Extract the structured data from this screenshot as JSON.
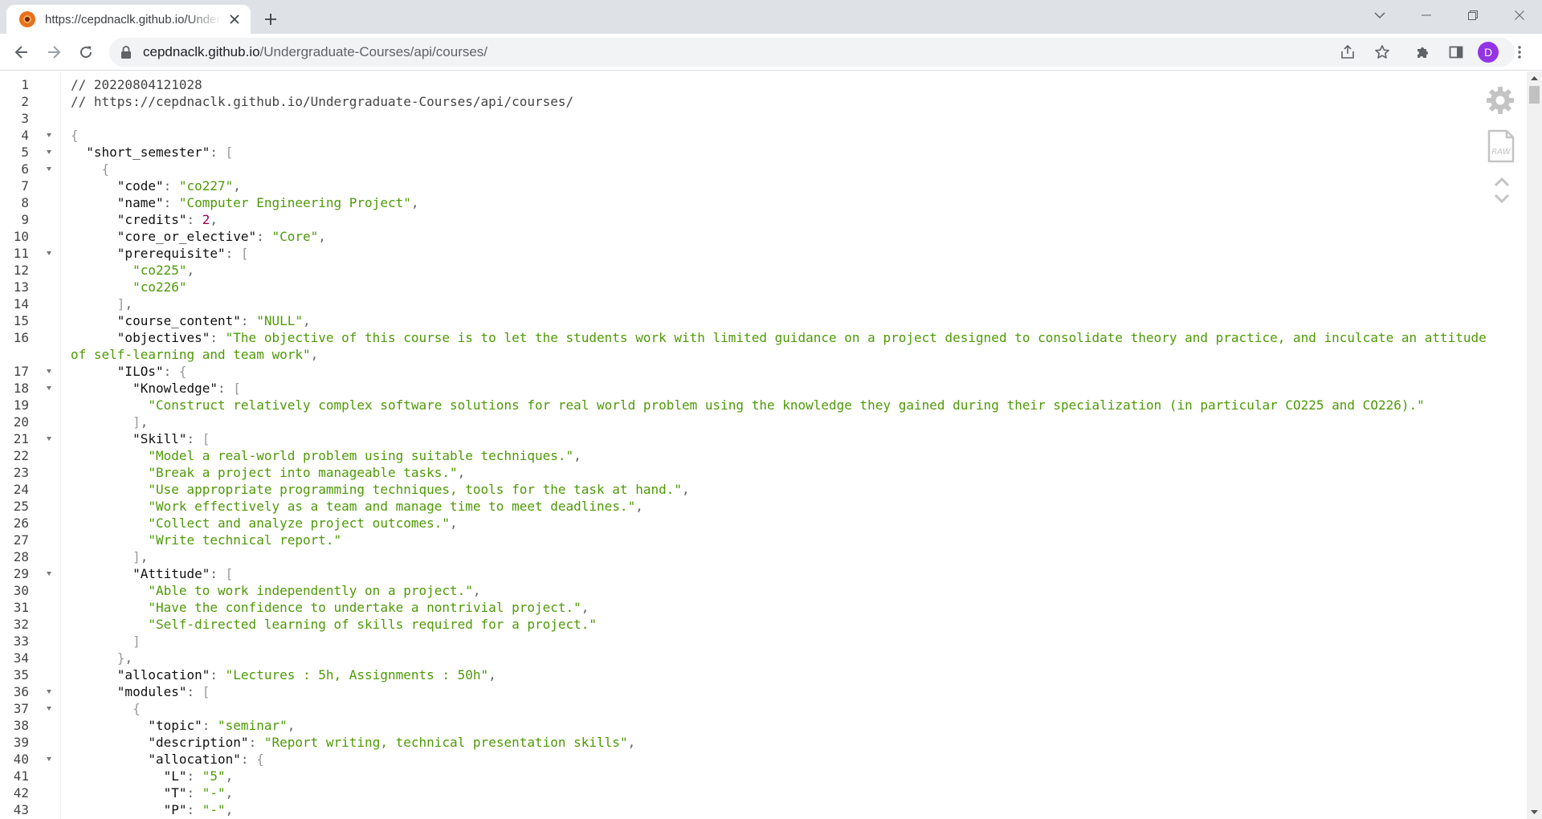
{
  "browser": {
    "tab_title": "https://cepdnaclk.github.io/Undergraduate-Courses/api/courses/",
    "url_host": "cepdnaclk.github.io",
    "url_path": "/Undergraduate-Courses/api/courses/",
    "profile_initial": "D"
  },
  "icons": {
    "favicon": "site-favicon",
    "tab_close": "close-icon",
    "new_tab": "plus-icon",
    "back": "arrow-left-icon",
    "forward": "arrow-right-icon",
    "reload": "reload-icon",
    "lock": "lock-icon",
    "share": "share-icon",
    "bookmark": "star-icon",
    "extensions": "puzzle-icon",
    "side_panel": "side-panel-icon",
    "menu": "kebab-menu-icon",
    "settings": "gear-icon",
    "raw": "raw-file-icon",
    "scroll_up": "chevron-up-icon",
    "scroll_down": "chevron-down-icon"
  },
  "viewer": {
    "raw_label": "RAW",
    "lines": [
      {
        "n": "1",
        "fold": false,
        "t": [
          [
            "c",
            "// 20220804121028"
          ]
        ]
      },
      {
        "n": "2",
        "fold": false,
        "t": [
          [
            "c",
            "// https://cepdnaclk.github.io/Undergraduate-Courses/api/courses/"
          ]
        ]
      },
      {
        "n": "3",
        "fold": false,
        "t": []
      },
      {
        "n": "4",
        "fold": true,
        "t": [
          [
            "b",
            "{"
          ]
        ]
      },
      {
        "n": "5",
        "fold": true,
        "t": [
          [
            "p",
            "  "
          ],
          [
            "k",
            "\"short_semester\""
          ],
          [
            "p",
            ": "
          ],
          [
            "b",
            "["
          ]
        ]
      },
      {
        "n": "6",
        "fold": true,
        "t": [
          [
            "p",
            "    "
          ],
          [
            "b",
            "{"
          ]
        ]
      },
      {
        "n": "7",
        "fold": false,
        "t": [
          [
            "p",
            "      "
          ],
          [
            "k",
            "\"code\""
          ],
          [
            "p",
            ": "
          ],
          [
            "s",
            "\"co227\""
          ],
          [
            "p",
            ","
          ]
        ]
      },
      {
        "n": "8",
        "fold": false,
        "t": [
          [
            "p",
            "      "
          ],
          [
            "k",
            "\"name\""
          ],
          [
            "p",
            ": "
          ],
          [
            "s",
            "\"Computer Engineering Project\""
          ],
          [
            "p",
            ","
          ]
        ]
      },
      {
        "n": "9",
        "fold": false,
        "t": [
          [
            "p",
            "      "
          ],
          [
            "k",
            "\"credits\""
          ],
          [
            "p",
            ": "
          ],
          [
            "n",
            "2"
          ],
          [
            "p",
            ","
          ]
        ]
      },
      {
        "n": "10",
        "fold": false,
        "t": [
          [
            "p",
            "      "
          ],
          [
            "k",
            "\"core_or_elective\""
          ],
          [
            "p",
            ": "
          ],
          [
            "s",
            "\"Core\""
          ],
          [
            "p",
            ","
          ]
        ]
      },
      {
        "n": "11",
        "fold": true,
        "t": [
          [
            "p",
            "      "
          ],
          [
            "k",
            "\"prerequisite\""
          ],
          [
            "p",
            ": "
          ],
          [
            "b",
            "["
          ]
        ]
      },
      {
        "n": "12",
        "fold": false,
        "t": [
          [
            "p",
            "        "
          ],
          [
            "s",
            "\"co225\""
          ],
          [
            "p",
            ","
          ]
        ]
      },
      {
        "n": "13",
        "fold": false,
        "t": [
          [
            "p",
            "        "
          ],
          [
            "s",
            "\"co226\""
          ]
        ]
      },
      {
        "n": "14",
        "fold": false,
        "t": [
          [
            "p",
            "      "
          ],
          [
            "b",
            "]"
          ],
          [
            "p",
            ","
          ]
        ]
      },
      {
        "n": "15",
        "fold": false,
        "t": [
          [
            "p",
            "      "
          ],
          [
            "k",
            "\"course_content\""
          ],
          [
            "p",
            ": "
          ],
          [
            "s",
            "\"NULL\""
          ],
          [
            "p",
            ","
          ]
        ]
      },
      {
        "n": "16",
        "fold": false,
        "t": [
          [
            "p",
            "      "
          ],
          [
            "k",
            "\"objectives\""
          ],
          [
            "p",
            ": "
          ],
          [
            "s",
            "\"The objective of this course is to let the students work with limited guidance on a project designed to consolidate theory and practice, and inculcate an attitude of self-learning and team work\""
          ],
          [
            "p",
            ","
          ]
        ]
      },
      {
        "n": "17",
        "fold": true,
        "t": [
          [
            "p",
            "      "
          ],
          [
            "k",
            "\"ILOs\""
          ],
          [
            "p",
            ": "
          ],
          [
            "b",
            "{"
          ]
        ]
      },
      {
        "n": "18",
        "fold": true,
        "t": [
          [
            "p",
            "        "
          ],
          [
            "k",
            "\"Knowledge\""
          ],
          [
            "p",
            ": "
          ],
          [
            "b",
            "["
          ]
        ]
      },
      {
        "n": "19",
        "fold": false,
        "t": [
          [
            "p",
            "          "
          ],
          [
            "s",
            "\"Construct relatively complex software solutions for real world problem using the knowledge they gained during their specialization (in particular CO225 and CO226).\""
          ]
        ]
      },
      {
        "n": "20",
        "fold": false,
        "t": [
          [
            "p",
            "        "
          ],
          [
            "b",
            "]"
          ],
          [
            "p",
            ","
          ]
        ]
      },
      {
        "n": "21",
        "fold": true,
        "t": [
          [
            "p",
            "        "
          ],
          [
            "k",
            "\"Skill\""
          ],
          [
            "p",
            ": "
          ],
          [
            "b",
            "["
          ]
        ]
      },
      {
        "n": "22",
        "fold": false,
        "t": [
          [
            "p",
            "          "
          ],
          [
            "s",
            "\"Model a real-world problem using suitable techniques.\""
          ],
          [
            "p",
            ","
          ]
        ]
      },
      {
        "n": "23",
        "fold": false,
        "t": [
          [
            "p",
            "          "
          ],
          [
            "s",
            "\"Break a project into manageable tasks.\""
          ],
          [
            "p",
            ","
          ]
        ]
      },
      {
        "n": "24",
        "fold": false,
        "t": [
          [
            "p",
            "          "
          ],
          [
            "s",
            "\"Use appropriate programming techniques, tools for the task at hand.\""
          ],
          [
            "p",
            ","
          ]
        ]
      },
      {
        "n": "25",
        "fold": false,
        "t": [
          [
            "p",
            "          "
          ],
          [
            "s",
            "\"Work effectively as a team and manage time to meet deadlines.\""
          ],
          [
            "p",
            ","
          ]
        ]
      },
      {
        "n": "26",
        "fold": false,
        "t": [
          [
            "p",
            "          "
          ],
          [
            "s",
            "\"Collect and analyze project outcomes.\""
          ],
          [
            "p",
            ","
          ]
        ]
      },
      {
        "n": "27",
        "fold": false,
        "t": [
          [
            "p",
            "          "
          ],
          [
            "s",
            "\"Write technical report.\""
          ]
        ]
      },
      {
        "n": "28",
        "fold": false,
        "t": [
          [
            "p",
            "        "
          ],
          [
            "b",
            "]"
          ],
          [
            "p",
            ","
          ]
        ]
      },
      {
        "n": "29",
        "fold": true,
        "t": [
          [
            "p",
            "        "
          ],
          [
            "k",
            "\"Attitude\""
          ],
          [
            "p",
            ": "
          ],
          [
            "b",
            "["
          ]
        ]
      },
      {
        "n": "30",
        "fold": false,
        "t": [
          [
            "p",
            "          "
          ],
          [
            "s",
            "\"Able to work independently on a project.\""
          ],
          [
            "p",
            ","
          ]
        ]
      },
      {
        "n": "31",
        "fold": false,
        "t": [
          [
            "p",
            "          "
          ],
          [
            "s",
            "\"Have the confidence to undertake a nontrivial project.\""
          ],
          [
            "p",
            ","
          ]
        ]
      },
      {
        "n": "32",
        "fold": false,
        "t": [
          [
            "p",
            "          "
          ],
          [
            "s",
            "\"Self-directed learning of skills required for a project.\""
          ]
        ]
      },
      {
        "n": "33",
        "fold": false,
        "t": [
          [
            "p",
            "        "
          ],
          [
            "b",
            "]"
          ]
        ]
      },
      {
        "n": "34",
        "fold": false,
        "t": [
          [
            "p",
            "      "
          ],
          [
            "b",
            "}"
          ],
          [
            "p",
            ","
          ]
        ]
      },
      {
        "n": "35",
        "fold": false,
        "t": [
          [
            "p",
            "      "
          ],
          [
            "k",
            "\"allocation\""
          ],
          [
            "p",
            ": "
          ],
          [
            "s",
            "\"Lectures : 5h, Assignments : 50h\""
          ],
          [
            "p",
            ","
          ]
        ]
      },
      {
        "n": "36",
        "fold": true,
        "t": [
          [
            "p",
            "      "
          ],
          [
            "k",
            "\"modules\""
          ],
          [
            "p",
            ": "
          ],
          [
            "b",
            "["
          ]
        ]
      },
      {
        "n": "37",
        "fold": true,
        "t": [
          [
            "p",
            "        "
          ],
          [
            "b",
            "{"
          ]
        ]
      },
      {
        "n": "38",
        "fold": false,
        "t": [
          [
            "p",
            "          "
          ],
          [
            "k",
            "\"topic\""
          ],
          [
            "p",
            ": "
          ],
          [
            "s",
            "\"seminar\""
          ],
          [
            "p",
            ","
          ]
        ]
      },
      {
        "n": "39",
        "fold": false,
        "t": [
          [
            "p",
            "          "
          ],
          [
            "k",
            "\"description\""
          ],
          [
            "p",
            ": "
          ],
          [
            "s",
            "\"Report writing, technical presentation skills\""
          ],
          [
            "p",
            ","
          ]
        ]
      },
      {
        "n": "40",
        "fold": true,
        "t": [
          [
            "p",
            "          "
          ],
          [
            "k",
            "\"allocation\""
          ],
          [
            "p",
            ": "
          ],
          [
            "b",
            "{"
          ]
        ]
      },
      {
        "n": "41",
        "fold": false,
        "t": [
          [
            "p",
            "            "
          ],
          [
            "k",
            "\"L\""
          ],
          [
            "p",
            ": "
          ],
          [
            "s",
            "\"5\""
          ],
          [
            "p",
            ","
          ]
        ]
      },
      {
        "n": "42",
        "fold": false,
        "t": [
          [
            "p",
            "            "
          ],
          [
            "k",
            "\"T\""
          ],
          [
            "p",
            ": "
          ],
          [
            "s",
            "\"-\""
          ],
          [
            "p",
            ","
          ]
        ]
      },
      {
        "n": "43",
        "fold": false,
        "t": [
          [
            "p",
            "            "
          ],
          [
            "k",
            "\"P\""
          ],
          [
            "p",
            ": "
          ],
          [
            "s",
            "\"-\""
          ],
          [
            "p",
            ","
          ]
        ]
      }
    ]
  }
}
